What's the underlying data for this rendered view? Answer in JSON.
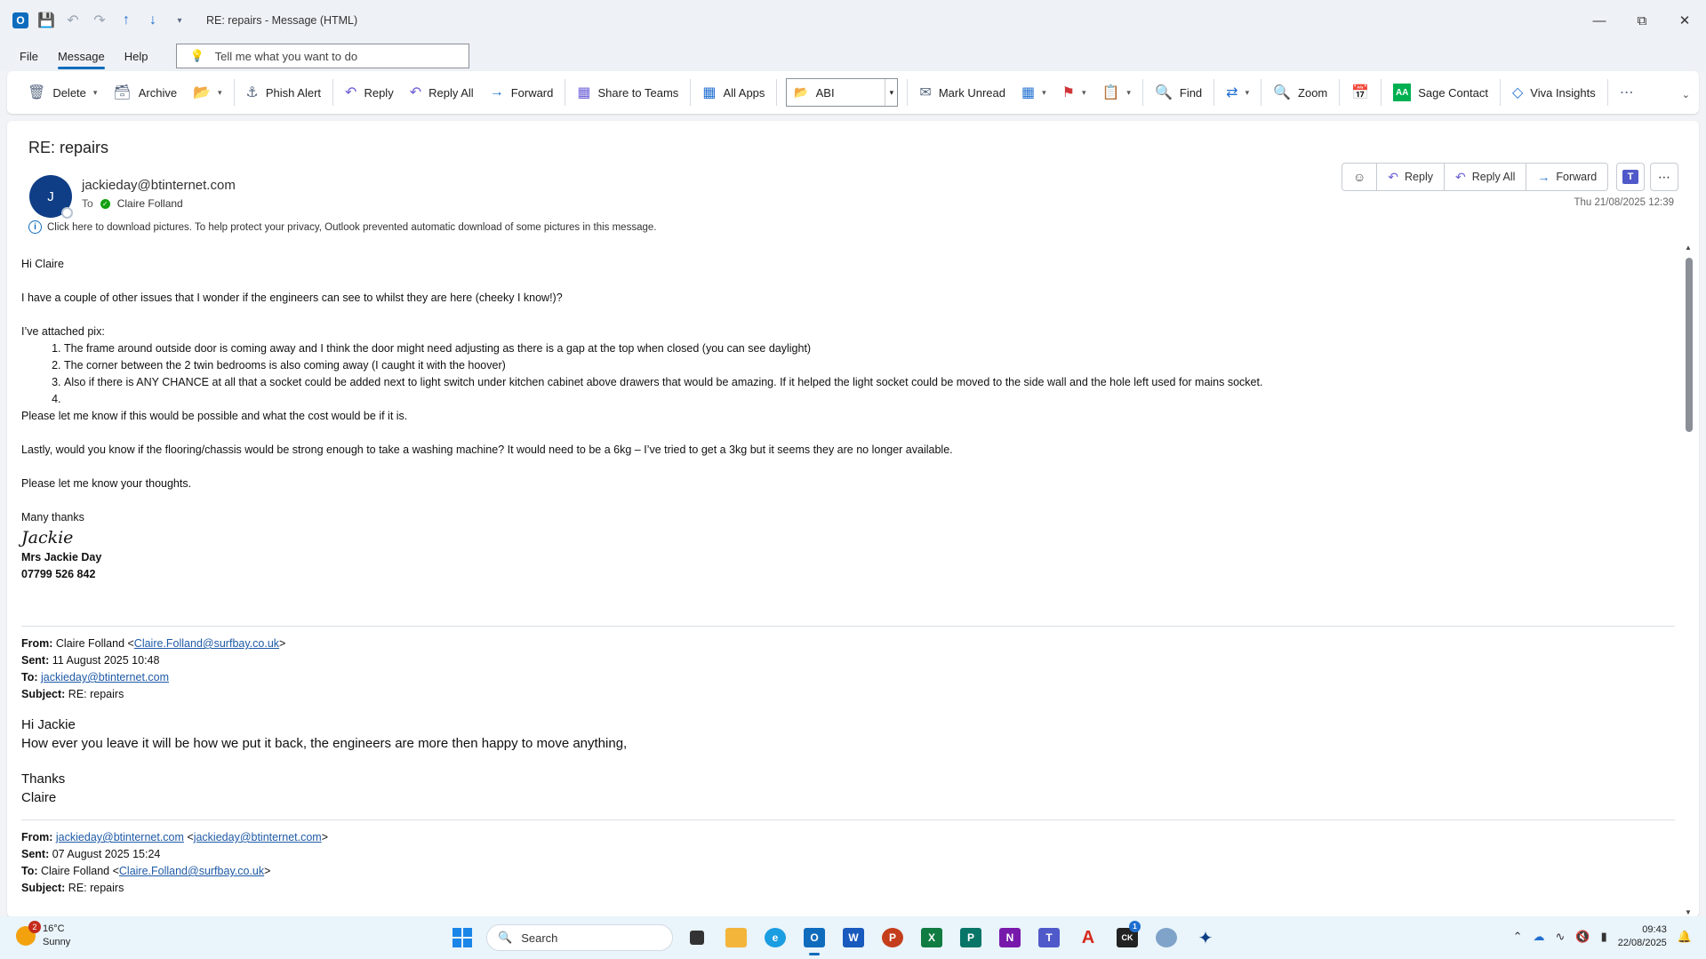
{
  "window": {
    "title": "RE: repairs  -  Message (HTML)"
  },
  "menu": {
    "items": [
      "File",
      "Message",
      "Help"
    ],
    "tellme": "Tell me what you want to do"
  },
  "ribbon": {
    "delete": "Delete",
    "archive": "Archive",
    "phish": "Phish Alert",
    "reply": "Reply",
    "reply_all": "Reply All",
    "forward": "Forward",
    "share_teams": "Share to Teams",
    "all_apps": "All Apps",
    "quick_step": "ABI",
    "mark_unread": "Mark Unread",
    "find": "Find",
    "zoom": "Zoom",
    "sage": "Sage Contact",
    "viva": "Viva Insights"
  },
  "message": {
    "subject": "RE: repairs",
    "avatar_initial": "J",
    "sender": "jackieday@btinternet.com",
    "to_label": "To",
    "to_name": "Claire Folland",
    "privacy_note": "Click here to download pictures. To help protect your privacy, Outlook prevented automatic download of some pictures in this message.",
    "timestamp": "Thu 21/08/2025 12:39",
    "actions": {
      "reply": "Reply",
      "reply_all": "Reply All",
      "forward": "Forward"
    }
  },
  "body": {
    "greeting": "Hi Claire",
    "intro": "I have a couple of other issues that I wonder if the engineers can see to whilst they are here (cheeky I know!)?",
    "attached": "I’ve attached pix:",
    "list": [
      "The frame around outside door is coming away and I think the door might need adjusting as there is a gap at the top when closed (you can see daylight)",
      "The corner between the 2 twin bedrooms is also coming away (I caught it with the hoover)",
      "Also if there is ANY CHANCE at all that a socket could be added next to light switch under kitchen cabinet above drawers that would be amazing.  If it helped the light socket could be moved to the side wall and the hole left used for mains socket.",
      ""
    ],
    "cost": "Please let me know if this would be possible and what the cost would be if it is.",
    "lastly": "Lastly, would you know if the flooring/chassis would be strong enough to take a washing machine?  It would need to be a 6kg – I’ve tried to get a 3kg but it seems they are no longer available.",
    "thoughts": "Please let me know your thoughts.",
    "thanks": "Many thanks",
    "signature": "Jackie",
    "sig_name": "Mrs Jackie Day",
    "sig_phone": "07799 526 842"
  },
  "quote1": {
    "from_label": "From:",
    "from_name": "Claire Folland <",
    "from_email": "Claire.Folland@surfbay.co.uk",
    "from_end": ">",
    "sent_label": "Sent:",
    "sent": "11 August 2025 10:48",
    "to_label": "To:",
    "to_email": "jackieday@btinternet.com",
    "subject_label": "Subject:",
    "subject": "RE: repairs",
    "greeting": "Hi Jackie",
    "text": "How ever you leave it will be how we put it back, the engineers are more then happy to move anything,",
    "thanks": "Thanks",
    "name": "Claire"
  },
  "quote2": {
    "from_label": "From:",
    "from_email": "jackieday@btinternet.com",
    "from_email2": "jackieday@btinternet.com",
    "sent_label": "Sent:",
    "sent": "07 August 2025 15:24",
    "to_label": "To:",
    "to_name": "Claire Folland <",
    "to_email": "Claire.Folland@surfbay.co.uk",
    "to_end": ">",
    "subject_label": "Subject:",
    "subject": "RE: repairs"
  },
  "taskbar": {
    "temp": "16°C",
    "weather": "Sunny",
    "weather_badge": "2",
    "search": "Search",
    "time": "09:43",
    "date": "22/08/2025",
    "app_badge": "1"
  }
}
